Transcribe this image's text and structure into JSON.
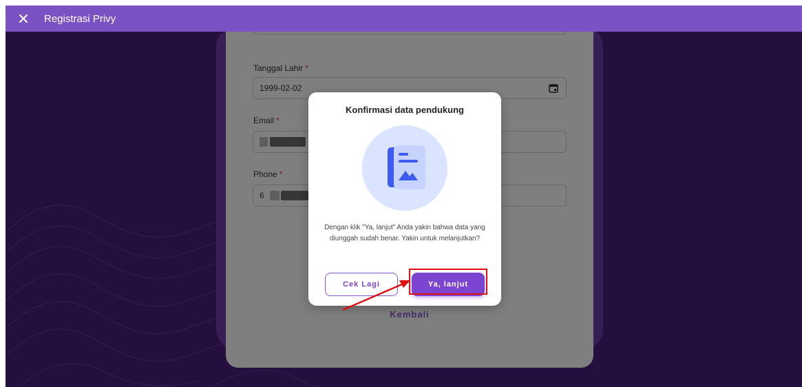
{
  "appbar": {
    "title": "Registrasi Privy",
    "close_icon": "close-icon"
  },
  "form": {
    "fields": [
      {
        "label": "Tanggal Lahir",
        "required_mark": "*",
        "value": "1999-02-02",
        "icon": "calendar-icon"
      },
      {
        "label": "Email",
        "required_mark": "*",
        "value": ""
      },
      {
        "label": "Phone",
        "required_mark": "*",
        "value": "6"
      }
    ],
    "back_label": "Kembali"
  },
  "modal": {
    "title": "Konfirmasi data pendukung",
    "illustration_icon": "document-image-icon",
    "message": "Dengan klik \"Ya, lanjut\" Anda yakin bahwa data yang diunggah sudah benar. Yakin untuk melanjutkan?",
    "secondary_button": "Cek Lagi",
    "primary_button": "Ya, lanjut"
  },
  "colors": {
    "appbar": "#7b52c4",
    "background": "#4a1f7c",
    "accent": "#7b45d1",
    "highlight": "#e01010"
  }
}
